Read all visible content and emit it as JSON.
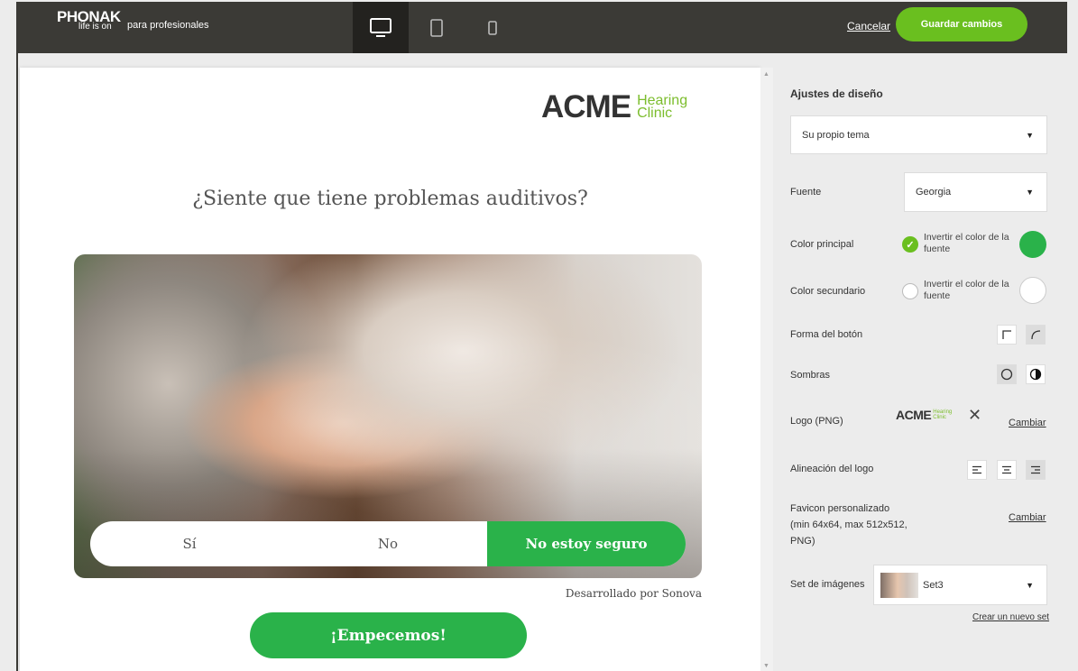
{
  "header": {
    "brand_name": "PHONAK",
    "brand_tagline": "life is on",
    "subtitle": "para profesionales",
    "devices": [
      "desktop",
      "tablet",
      "phone"
    ],
    "cancel_label": "Cancelar",
    "save_label": "Guardar cambios"
  },
  "preview": {
    "logo_word": "ACME",
    "logo_sub_1": "Hearing",
    "logo_sub_2": "Clinic",
    "question": "¿Siente que tiene problemas auditivos?",
    "answers": [
      "Sí",
      "No",
      "No estoy seguro"
    ],
    "powered_by": "Desarrollado por Sonova",
    "start_label": "¡Empecemos!"
  },
  "settings": {
    "title": "Ajustes de diseño",
    "theme_value": "Su propio tema",
    "font_label": "Fuente",
    "font_value": "Georgia",
    "primary_label": "Color principal",
    "primary_invert_label": "Invertir el color de la fuente",
    "primary_invert_checked": true,
    "primary_color": "#2ab24a",
    "secondary_label": "Color secundario",
    "secondary_invert_label": "Invertir el color de la fuente",
    "secondary_invert_checked": false,
    "secondary_color": "#ffffff",
    "button_shape_label": "Forma del botón",
    "shadows_label": "Sombras",
    "logo_label": "Logo (PNG)",
    "logo_change": "Cambiar",
    "logo_align_label": "Alineación del logo",
    "logo_align_selected": "right",
    "favicon_label": "Favicon personalizado (min 64x64, max 512x512, PNG)",
    "favicon_change": "Cambiar",
    "image_set_label": "Set de imágenes",
    "image_set_value": "Set3",
    "create_set_link": "Crear un nuevo set"
  }
}
